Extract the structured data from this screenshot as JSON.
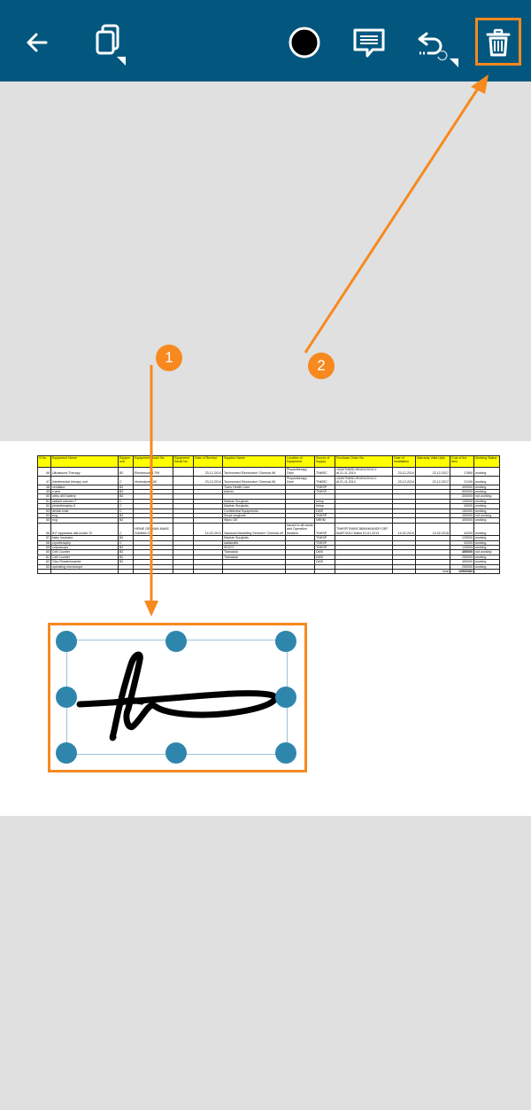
{
  "toolbar": {
    "background": "#03577e",
    "buttons": [
      {
        "name": "back-button",
        "icon": "arrow-left-icon"
      },
      {
        "name": "copy-button",
        "icon": "copy-icon"
      },
      {
        "name": "color-button",
        "icon": "black-circle-icon"
      },
      {
        "name": "comment-button",
        "icon": "comment-icon"
      },
      {
        "name": "undo-button",
        "icon": "undo-icon"
      },
      {
        "name": "delete-button",
        "icon": "trash-icon"
      }
    ]
  },
  "annotations": {
    "accent": "#f7891f",
    "badges": [
      "1",
      "2"
    ]
  },
  "sheet": {
    "headers": [
      "S.No.",
      "Equipment Name",
      "Equipm unit",
      "Equipment Model No",
      "Equipment Serial No",
      "Date of Receipt",
      "Supplier Name",
      "Location of Equipment",
      "Source of Supply",
      "Purchase Order No",
      "Date of Installation",
      "Warranty Valid Upto",
      "Cost of the item",
      "Working Status"
    ],
    "rows": [
      [
        "46",
        "Ultrasound Therapy",
        "B2",
        "Electrosound 709",
        "",
        "23-12-2014",
        "Technomed Electronics* Chennai-96",
        "Physiotherapy Dept",
        "TNMSC",
        "1526/TNMSC/ENGG/2014-2 dt.21.11.2014",
        "23-12-2014",
        "22-12-2017",
        "17850",
        "working"
      ],
      [
        "47",
        "Interferential therapy unit",
        "C",
        "Vectrodyne 100",
        "",
        "23-12-2014",
        "Technomed Electronics* Chennai-96",
        "Physiotherapy Dept",
        "TNMSC",
        "1526/TNMSC/ENGG/2014-2 dt.21.11.2014",
        "23-12-2014",
        "22-12-2017",
        "21190",
        "working"
      ],
      [
        "48",
        "ventilator",
        "B2",
        "",
        "",
        "",
        "Trans Health Care",
        "",
        "TNHSP",
        "",
        "",
        "",
        "400000",
        "working"
      ],
      [
        "49",
        "c-arm",
        "B2",
        "",
        "",
        "",
        "Adenis",
        "",
        "TNHSP",
        "",
        "",
        "",
        "500000",
        "working"
      ],
      [
        "50",
        "ortho drill battery",
        "B2",
        "",
        "",
        "",
        "",
        "",
        "",
        "",
        "",
        "",
        "300000",
        "not working"
      ],
      [
        "51",
        "radiant warmer-7",
        "C",
        "",
        "",
        "",
        "Madras Surgicals",
        "",
        "tnhsp",
        "",
        "",
        "",
        "140000",
        "working"
      ],
      [
        "52",
        "phototheraphy-5",
        "C",
        "",
        "",
        "",
        "Madras Surgicals",
        "",
        "tnhsp",
        "",
        "",
        "",
        "40000",
        "working"
      ],
      [
        "53",
        "dental chair",
        "C",
        "",
        "",
        "",
        "Confidential Equipments",
        "",
        "DMS",
        "",
        "",
        "",
        "150000",
        "working"
      ],
      [
        "54",
        "ecg",
        "B2",
        "",
        "",
        "",
        "Surya surgicals",
        "",
        "TNHSP",
        "",
        "",
        "",
        "450000",
        "not working"
      ],
      [
        "55",
        "ecg",
        "B2",
        "",
        "",
        "",
        "Wipro GE",
        "",
        "NRHM",
        "",
        "",
        "",
        "450000",
        "working"
      ],
      [
        "56",
        "B.P apparatus dial model-70",
        "C",
        "HEINE GERMAN MAKE GAMMA G",
        "",
        "14-02-2013",
        "Vaassani Marketing Services* Chennai-49",
        "Issued to all wards and Operation theaters",
        "TNHSP",
        "TNHSP/TNMSC/BMWM/UNDP-GEF MoEF/2012 Dated 01.01.2013",
        "14-02-2013",
        "13-02-2018",
        "44200",
        "working"
      ],
      [
        "57",
        "baby incubator",
        "B2",
        "",
        "",
        "",
        "Madras Surgicals",
        "",
        "TNHSP",
        "",
        "",
        "",
        "125000",
        "working"
      ],
      [
        "58",
        "cryotheraphy",
        "C",
        "",
        "",
        "",
        "sakskrafts",
        "",
        "TNHSP",
        "",
        "",
        "",
        "32000",
        "working"
      ],
      [
        "59",
        "colposcope",
        "B2",
        "",
        "",
        "",
        "SISCO",
        "",
        "TNHSP",
        "",
        "",
        "",
        "125000",
        "working"
      ],
      [
        "60",
        "Cell Counter",
        "B2",
        "",
        "",
        "",
        "Transasia",
        "",
        "DMS",
        "",
        "",
        "",
        "450000",
        "not working"
      ],
      [
        "61",
        "Cell Counter",
        "B2",
        "",
        "",
        "",
        "Transasia",
        "",
        "DMS",
        "",
        "",
        "",
        "250000",
        "working"
      ],
      [
        "62",
        "Glco Reader/washer",
        "B2",
        "",
        "",
        "",
        "",
        "",
        "DMS",
        "",
        "",
        "",
        "450000",
        "working"
      ],
      [
        "63",
        "operating microscope",
        "",
        "",
        "",
        "",
        "",
        "",
        "",
        "",
        "",
        "",
        "250000",
        "working"
      ],
      [
        "",
        "",
        "",
        "",
        "",
        "",
        "",
        "",
        "",
        "",
        "",
        "total",
        "10569383",
        ""
      ]
    ]
  },
  "signature": {
    "stroke_color": "#000000",
    "handle_color": "#2f86ad",
    "frame_color": "#9bc3d6"
  }
}
